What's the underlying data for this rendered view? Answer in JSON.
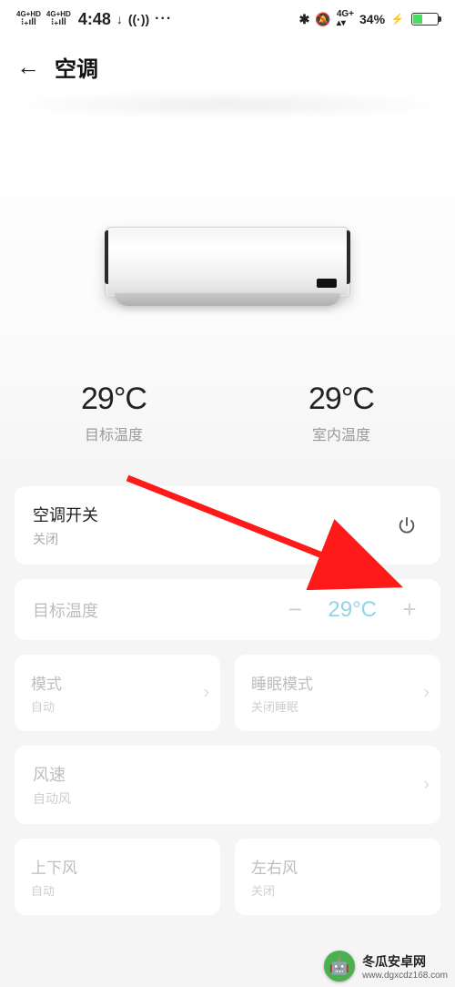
{
  "status": {
    "signal1_top": "4G+HD",
    "signal2_top": "4G+HD",
    "time": "4:48",
    "download_icon": "↓",
    "hotspot": "((·))",
    "more": "···",
    "bt_icon": "✱",
    "bell_icon": "🔕",
    "net_top": "4G+",
    "battery_pct": "34%"
  },
  "header": {
    "back_glyph": "←",
    "title": "空调"
  },
  "temps": {
    "target_value": "29°C",
    "target_label": "目标温度",
    "indoor_value": "29°C",
    "indoor_label": "室内温度"
  },
  "switch_card": {
    "title": "空调开关",
    "status": "关闭"
  },
  "target_card": {
    "label": "目标温度",
    "minus": "−",
    "value": "29°C",
    "plus": "+"
  },
  "mode_card": {
    "title": "模式",
    "sub": "自动"
  },
  "sleep_card": {
    "title": "睡眠模式",
    "sub": "关闭睡眠"
  },
  "fan_card": {
    "title": "风速",
    "sub": "自动风"
  },
  "ud_card": {
    "title": "上下风",
    "sub": "自动"
  },
  "lr_card": {
    "title": "左右风",
    "sub": "关闭"
  },
  "watermark": {
    "name": "冬瓜安卓网",
    "url": "www.dgxcdz168.com"
  }
}
